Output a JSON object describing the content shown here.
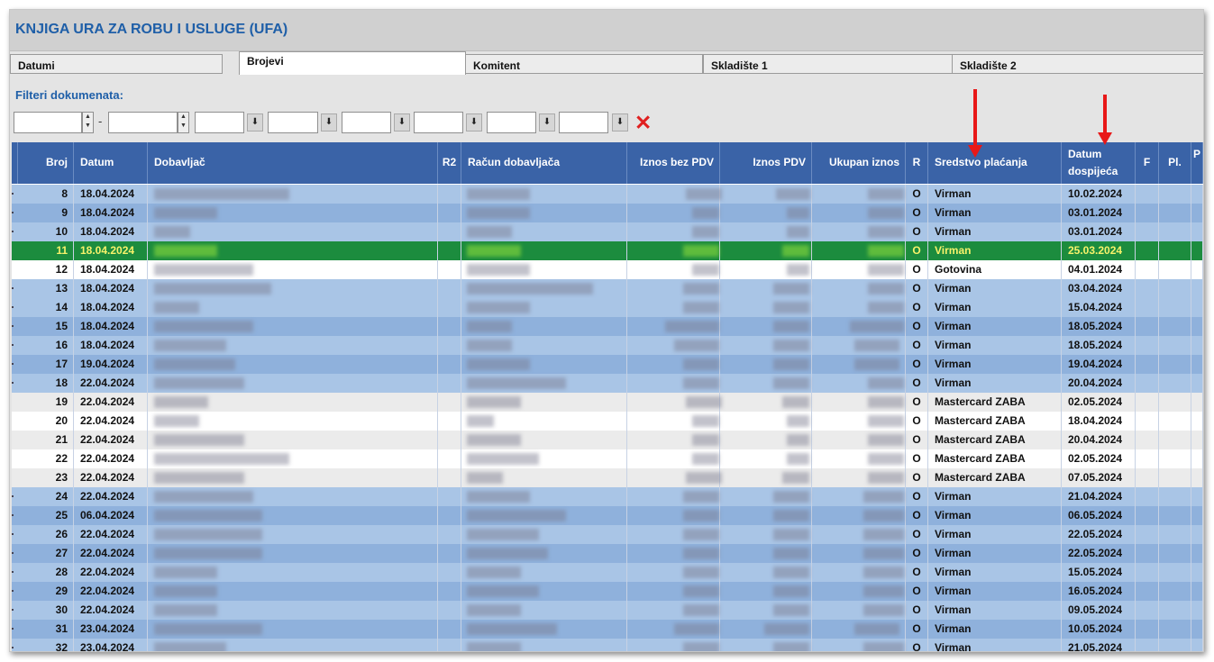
{
  "window": {
    "title": "KNJIGA URA ZA ROBU I USLUGE (UFA)"
  },
  "tabs": [
    {
      "label": "Datumi"
    },
    {
      "label": "Brojevi"
    },
    {
      "label": "Komitent"
    },
    {
      "label": "Skladište 1"
    },
    {
      "label": "Skladište 2"
    }
  ],
  "active_tab": "Brojevi",
  "filters": {
    "label": "Filteri dokumenata:",
    "separator": "-",
    "from_value": "",
    "to_value": "",
    "clear_icon": "close-icon",
    "clear_color": "#e02020"
  },
  "table": {
    "headers": {
      "broj": "Broj",
      "datum": "Datum",
      "dobavljac": "Dobavljač",
      "r2": "R2",
      "racun": "Račun dobavljača",
      "iznos_bez_pdv": "Iznos bez PDV",
      "iznos_pdv": "Iznos PDV",
      "ukupan_iznos": "Ukupan iznos",
      "r": "R",
      "sredstvo": "Sredstvo plaćanja",
      "datum_dospijeca_1": "Datum",
      "datum_dospijeca_2": "dospijeća",
      "f": "F",
      "pl": "Pl.",
      "p": "P"
    },
    "rows": [
      {
        "broj": "8",
        "datum": "18.04.2024",
        "r": "O",
        "sredstvo": "Virman",
        "dospijece": "10.02.2024"
      },
      {
        "broj": "9",
        "datum": "18.04.2024",
        "r": "O",
        "sredstvo": "Virman",
        "dospijece": "03.01.2024"
      },
      {
        "broj": "10",
        "datum": "18.04.2024",
        "r": "O",
        "sredstvo": "Virman",
        "dospijece": "03.01.2024"
      },
      {
        "broj": "11",
        "datum": "18.04.2024",
        "r": "O",
        "sredstvo": "Virman",
        "dospijece": "25.03.2024"
      },
      {
        "broj": "12",
        "datum": "18.04.2024",
        "r": "O",
        "sredstvo": "Gotovina",
        "dospijece": "04.01.2024"
      },
      {
        "broj": "13",
        "datum": "18.04.2024",
        "r": "O",
        "sredstvo": "Virman",
        "dospijece": "03.04.2024"
      },
      {
        "broj": "14",
        "datum": "18.04.2024",
        "r": "O",
        "sredstvo": "Virman",
        "dospijece": "15.04.2024"
      },
      {
        "broj": "15",
        "datum": "18.04.2024",
        "r": "O",
        "sredstvo": "Virman",
        "dospijece": "18.05.2024"
      },
      {
        "broj": "16",
        "datum": "18.04.2024",
        "r": "O",
        "sredstvo": "Virman",
        "dospijece": "18.05.2024"
      },
      {
        "broj": "17",
        "datum": "19.04.2024",
        "r": "O",
        "sredstvo": "Virman",
        "dospijece": "19.04.2024"
      },
      {
        "broj": "18",
        "datum": "22.04.2024",
        "r": "O",
        "sredstvo": "Virman",
        "dospijece": "20.04.2024"
      },
      {
        "broj": "19",
        "datum": "22.04.2024",
        "r": "O",
        "sredstvo": "Mastercard ZABA",
        "dospijece": "02.05.2024"
      },
      {
        "broj": "20",
        "datum": "22.04.2024",
        "r": "O",
        "sredstvo": "Mastercard ZABA",
        "dospijece": "18.04.2024"
      },
      {
        "broj": "21",
        "datum": "22.04.2024",
        "r": "O",
        "sredstvo": "Mastercard ZABA",
        "dospijece": "20.04.2024"
      },
      {
        "broj": "22",
        "datum": "22.04.2024",
        "r": "O",
        "sredstvo": "Mastercard ZABA",
        "dospijece": "02.05.2024"
      },
      {
        "broj": "23",
        "datum": "22.04.2024",
        "r": "O",
        "sredstvo": "Mastercard ZABA",
        "dospijece": "07.05.2024"
      },
      {
        "broj": "24",
        "datum": "22.04.2024",
        "r": "O",
        "sredstvo": "Virman",
        "dospijece": "21.04.2024"
      },
      {
        "broj": "25",
        "datum": "06.04.2024",
        "r": "O",
        "sredstvo": "Virman",
        "dospijece": "06.05.2024"
      },
      {
        "broj": "26",
        "datum": "22.04.2024",
        "r": "O",
        "sredstvo": "Virman",
        "dospijece": "22.05.2024"
      },
      {
        "broj": "27",
        "datum": "22.04.2024",
        "r": "O",
        "sredstvo": "Virman",
        "dospijece": "22.05.2024"
      },
      {
        "broj": "28",
        "datum": "22.04.2024",
        "r": "O",
        "sredstvo": "Virman",
        "dospijece": "15.05.2024"
      },
      {
        "broj": "29",
        "datum": "22.04.2024",
        "r": "O",
        "sredstvo": "Virman",
        "dospijece": "16.05.2024"
      },
      {
        "broj": "30",
        "datum": "22.04.2024",
        "r": "O",
        "sredstvo": "Virman",
        "dospijece": "09.05.2024"
      },
      {
        "broj": "31",
        "datum": "23.04.2024",
        "r": "O",
        "sredstvo": "Virman",
        "dospijece": "10.05.2024"
      },
      {
        "broj": "32",
        "datum": "23.04.2024",
        "r": "O",
        "sredstvo": "Virman",
        "dospijece": "21.05.2024"
      }
    ],
    "selected_row_index": 3,
    "selected_row_color": "#1c8c3e",
    "selected_text_color": "#f7f26a",
    "header_color": "#3a63a7"
  },
  "annotations": {
    "arrow_color": "#e81818"
  }
}
